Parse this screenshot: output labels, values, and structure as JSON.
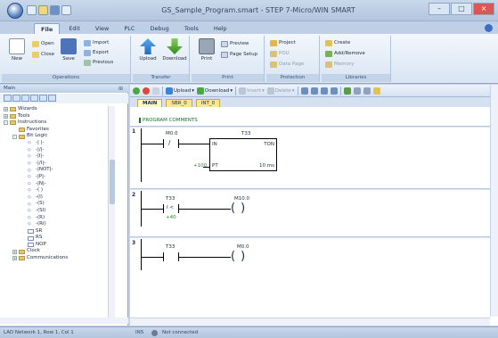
{
  "window": {
    "title": "GS_Sample_Program.smart - STEP 7-Micro/WIN SMART"
  },
  "ribbon_tabs": [
    "File",
    "Edit",
    "View",
    "PLC",
    "Debug",
    "Tools",
    "Help"
  ],
  "ribbon": {
    "operations": {
      "caption": "Operations",
      "new": "New",
      "open": "Open",
      "close": "Close",
      "save": "Save",
      "import": "Import",
      "export": "Export",
      "previous": "Previous"
    },
    "transfer": {
      "caption": "Transfer",
      "upload": "Upload",
      "download": "Download"
    },
    "print": {
      "caption": "Print",
      "print": "Print",
      "preview": "Preview",
      "page_setup": "Page Setup"
    },
    "protection": {
      "caption": "Protection",
      "project": "Project",
      "pou": "POU",
      "data_page": "Data Page"
    },
    "libraries": {
      "caption": "Libraries",
      "create": "Create",
      "add_remove": "Add/Remove",
      "memory": "Memory"
    }
  },
  "left_panel": {
    "title": "Main",
    "tree": [
      {
        "label": "Wizards",
        "depth": 0,
        "kind": "folder",
        "toggle": "+"
      },
      {
        "label": "Tools",
        "depth": 0,
        "kind": "folder",
        "toggle": "+"
      },
      {
        "label": "Instructions",
        "depth": 0,
        "kind": "folder",
        "toggle": "-"
      },
      {
        "label": "Favorites",
        "depth": 1,
        "kind": "folder",
        "toggle": ""
      },
      {
        "label": "Bit Logic",
        "depth": 1,
        "kind": "folder",
        "toggle": "-"
      },
      {
        "label": "-| |-",
        "depth": 2,
        "kind": "instr",
        "toggle": ""
      },
      {
        "label": "-|/|-",
        "depth": 2,
        "kind": "instr",
        "toggle": ""
      },
      {
        "label": "-|I|-",
        "depth": 2,
        "kind": "instr",
        "toggle": ""
      },
      {
        "label": "-|/I|-",
        "depth": 2,
        "kind": "instr",
        "toggle": ""
      },
      {
        "label": "-|NOT|-",
        "depth": 2,
        "kind": "instr",
        "toggle": ""
      },
      {
        "label": "-|P|-",
        "depth": 2,
        "kind": "instr",
        "toggle": ""
      },
      {
        "label": "-|N|-",
        "depth": 2,
        "kind": "instr",
        "toggle": ""
      },
      {
        "label": "-( )",
        "depth": 2,
        "kind": "instr",
        "toggle": ""
      },
      {
        "label": "-(I)",
        "depth": 2,
        "kind": "instr",
        "toggle": ""
      },
      {
        "label": "-(S)",
        "depth": 2,
        "kind": "instr",
        "toggle": ""
      },
      {
        "label": "-(SI)",
        "depth": 2,
        "kind": "instr",
        "toggle": ""
      },
      {
        "label": "-(R)",
        "depth": 2,
        "kind": "instr",
        "toggle": ""
      },
      {
        "label": "-(RI)",
        "depth": 2,
        "kind": "instr",
        "toggle": ""
      },
      {
        "label": "SR",
        "depth": 2,
        "kind": "box",
        "toggle": ""
      },
      {
        "label": "RS",
        "depth": 2,
        "kind": "box",
        "toggle": ""
      },
      {
        "label": "NOP",
        "depth": 2,
        "kind": "box",
        "toggle": ""
      },
      {
        "label": "Clock",
        "depth": 1,
        "kind": "folder",
        "toggle": "+"
      },
      {
        "label": "Communications",
        "depth": 1,
        "kind": "folder",
        "toggle": "+"
      }
    ]
  },
  "editor": {
    "toolbar": {
      "upload": "Upload",
      "download": "Download",
      "insert": "Insert",
      "delete": "Delete"
    },
    "pou_tabs": [
      "MAIN",
      "SBR_0",
      "INT_0"
    ],
    "program_comments": "PROGRAM COMMENTS",
    "networks": [
      {
        "number": "1",
        "contact": "M0.0",
        "contact_type": "/",
        "timer": "T33",
        "in": "IN",
        "type": "TON",
        "pt_value": "+100",
        "pt": "PT",
        "base": "10 ms"
      },
      {
        "number": "2",
        "contact": "T33",
        "contact_type": "I <",
        "contact_value": "+40",
        "coil": "M10.0"
      },
      {
        "number": "3",
        "contact": "T33",
        "coil": "M0.0"
      }
    ]
  },
  "statusbar": {
    "position": "LAD Network 1, Row 1, Col 1",
    "mode": "INS",
    "connection": "Not connected"
  },
  "colors": {
    "ribbon_bg": "#d9e5f3",
    "pou_tab": "#f7e793",
    "comment": "#1d6b2b"
  }
}
